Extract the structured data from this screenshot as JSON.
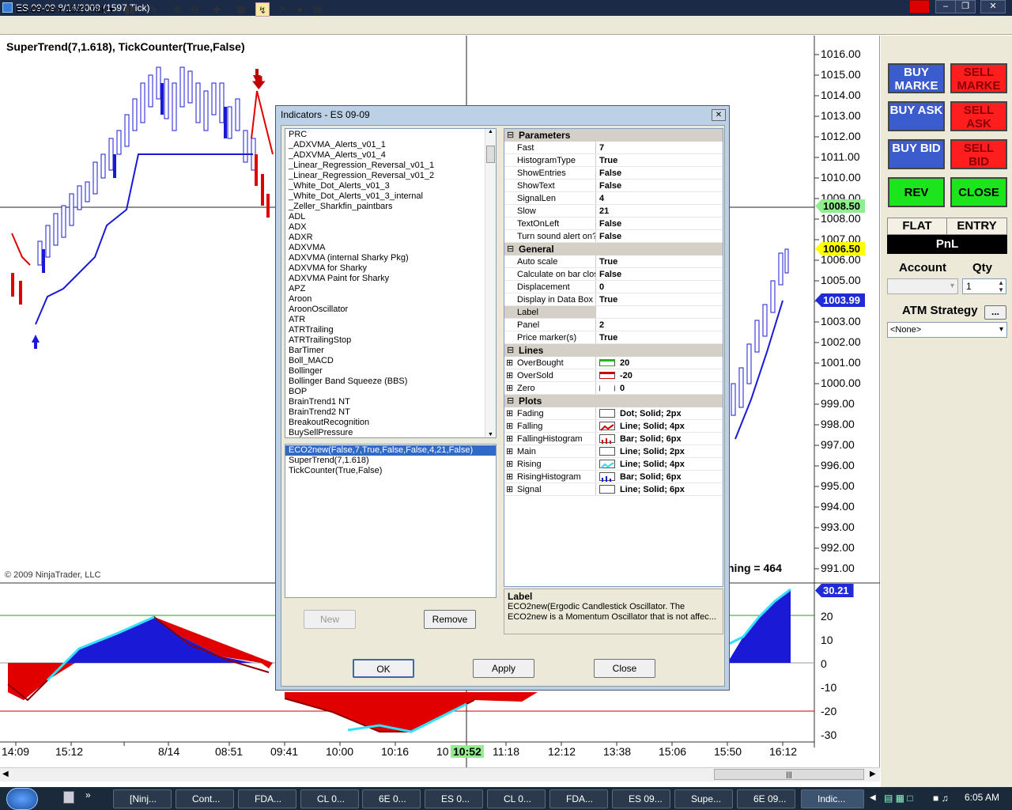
{
  "window": {
    "title": "ES 09-09  8/14/2009 (1597 Tick)"
  },
  "toolbar": {
    "instrument": "ES 09-09",
    "period": "1597 Tick"
  },
  "chart": {
    "indicator_label": "SuperTrend(7,1.618), TickCounter(True,False)",
    "copyright": "© 2009 NinjaTrader, LLC",
    "tick_counter_text": "ning = 464",
    "price_labels": [
      "1016.00",
      "1015.00",
      "1014.00",
      "1013.00",
      "1012.00",
      "1011.00",
      "1010.00",
      "1009.00",
      "1008.00",
      "1007.00",
      "1006.00",
      "1005.00",
      "1004.00",
      "1003.00",
      "1002.00",
      "1001.00",
      "1000.00",
      "999.00",
      "998.00",
      "997.00",
      "996.00",
      "995.00",
      "994.00",
      "993.00",
      "992.00",
      "991.00"
    ],
    "price_markers": [
      {
        "text": "1008.50",
        "color": "#90ee90"
      },
      {
        "text": "1006.50",
        "color": "#ffff00"
      },
      {
        "text": "1003.99",
        "color": "#1e2bd6"
      }
    ],
    "osc_labels": [
      "20",
      "10",
      "0",
      "-10",
      "-20",
      "-30"
    ],
    "osc_marker": "30.21",
    "time_labels": [
      "14:09",
      "15:12",
      "8/14",
      "08:51",
      "09:41",
      "10:00",
      "10:16",
      "10",
      "10:52",
      "11:18",
      "12:12",
      "13:38",
      "15:06",
      "15:50",
      "16:12"
    ]
  },
  "trade_panel": {
    "buy_market": "BUY MARKE",
    "sell_market": "SELL MARKE",
    "buy_ask": "BUY ASK",
    "sell_ask": "SELL ASK",
    "buy_bid": "BUY BID",
    "sell_bid": "SELL BID",
    "rev": "REV",
    "close": "CLOSE",
    "flat": "FLAT",
    "entry": "ENTRY",
    "pnl": "PnL",
    "account_label": "Account",
    "qty_label": "Qty",
    "qty_value": "1",
    "atm_label": "ATM Strategy",
    "atm_btn": "...",
    "atm_value": "<None>"
  },
  "dialog": {
    "title": "Indicators - ES 09-09",
    "indicators": [
      "PRC",
      "_ADXVMA_Alerts_v01_1",
      "_ADXVMA_Alerts_v01_4",
      "_Linear_Regression_Reversal_v01_1",
      "_Linear_Regression_Reversal_v01_2",
      "_White_Dot_Alerts_v01_3",
      "_White_Dot_Alerts_v01_3_internal",
      "_Zeller_Sharkfin_paintbars",
      "ADL",
      "ADX",
      "ADXR",
      "ADXVMA",
      "ADXVMA (internal Sharky Pkg)",
      "ADXVMA for Sharky",
      "ADXVMA Paint for Sharky",
      "APZ",
      "Aroon",
      "AroonOscillator",
      "ATR",
      "ATRTrailing",
      "ATRTrailingStop",
      "BarTimer",
      "Boll_MACD",
      "Bollinger",
      "Bollinger Band Squeeze (BBS)",
      "BOP",
      "BrainTrend1 NT",
      "BrainTrend2 NT",
      "BreakoutRecognition",
      "BuySellPressure"
    ],
    "applied": [
      "ECO2new(False,7,True,False,False,4,21,False)",
      "SuperTrend(7,1.618)",
      "TickCounter(True,False)"
    ],
    "new_btn": "New",
    "remove_btn": "Remove",
    "properties": [
      {
        "category": "Parameters",
        "rows": [
          [
            "Fast",
            "7"
          ],
          [
            "HistogramType",
            "True"
          ],
          [
            "ShowEntries",
            "False"
          ],
          [
            "ShowText",
            "False"
          ],
          [
            "SignalLen",
            "4"
          ],
          [
            "Slow",
            "21"
          ],
          [
            "TextOnLeft",
            "False"
          ],
          [
            "Turn sound alert on?",
            "False"
          ]
        ]
      },
      {
        "category": "General",
        "rows": [
          [
            "Auto scale",
            "True"
          ],
          [
            "Calculate on bar close",
            "False"
          ],
          [
            "Displacement",
            "0"
          ],
          [
            "Display in Data Box",
            "True"
          ],
          [
            "Label",
            ""
          ],
          [
            "Panel",
            "2"
          ],
          [
            "Price marker(s)",
            "True"
          ]
        ]
      },
      {
        "category": "Lines",
        "rows": [
          [
            "OverBought",
            "20"
          ],
          [
            "OverSold",
            "-20"
          ],
          [
            "Zero",
            "0"
          ]
        ]
      },
      {
        "category": "Plots",
        "rows": [
          [
            "Fading",
            "Dot; Solid; 2px"
          ],
          [
            "Falling",
            "Line; Solid; 4px"
          ],
          [
            "FallingHistogram",
            "Bar; Solid; 6px"
          ],
          [
            "Main",
            "Line; Solid; 2px"
          ],
          [
            "Rising",
            "Line; Solid; 4px"
          ],
          [
            "RisingHistogram",
            "Bar; Solid; 6px"
          ],
          [
            "Signal",
            "Line; Solid; 6px"
          ]
        ]
      }
    ],
    "help_title": "Label",
    "help_text": "ECO2new(Ergodic Candlestick Oscillator.  The ECO2new is a Momentum Oscillator that is not affec...",
    "ok_btn": "OK",
    "apply_btn": "Apply",
    "close_btn": "Close"
  },
  "taskbar": {
    "tasks": [
      "[Ninj...",
      "Cont...",
      "FDA...",
      "CL 0...",
      "6E 0...",
      "ES 0...",
      "CL 0...",
      "FDA...",
      "ES 09...",
      "Supe...",
      "6E 09...",
      "Indic..."
    ],
    "clock": "6:05 AM"
  }
}
